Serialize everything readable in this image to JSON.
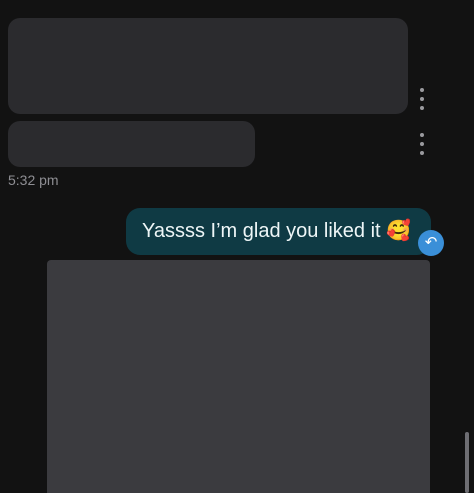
{
  "messages": {
    "incoming": [
      {
        "text": ""
      },
      {
        "text": ""
      }
    ],
    "timestamp": "5:32 pm",
    "outgoing": [
      {
        "text": "Yassss I’m glad you liked it 🥰"
      }
    ]
  },
  "icons": {
    "more": "more-vertical-icon",
    "reply": "reply-icon",
    "reply_glyph": "↶"
  },
  "colors": {
    "background": "#121212",
    "incoming_bubble": "#2b2b2e",
    "outgoing_bubble": "#0f3a44",
    "reply_badge": "#3a8fd8"
  }
}
